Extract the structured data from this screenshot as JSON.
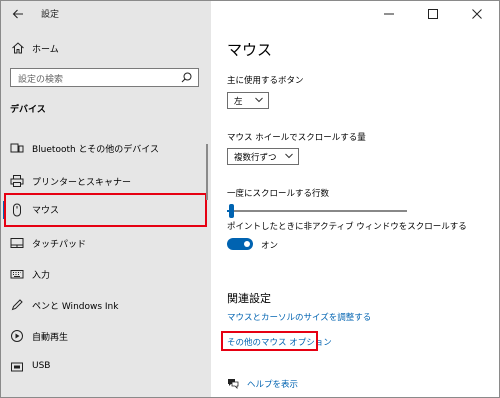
{
  "window": {
    "title": "設定",
    "controls": [
      "minimize-icon",
      "maximize-icon",
      "close-icon"
    ]
  },
  "sidebar": {
    "home_label": "ホーム",
    "search_placeholder": "設定の検索",
    "section_title": "デバイス",
    "items": [
      {
        "label": "Bluetooth とその他のデバイス",
        "icon": "bluetooth-devices-icon"
      },
      {
        "label": "プリンターとスキャナー",
        "icon": "printer-icon"
      },
      {
        "label": "マウス",
        "icon": "mouse-icon",
        "active": true
      },
      {
        "label": "タッチパッド",
        "icon": "touchpad-icon"
      },
      {
        "label": "入力",
        "icon": "keyboard-icon"
      },
      {
        "label": "ペンと Windows Ink",
        "icon": "pen-icon"
      },
      {
        "label": "自動再生",
        "icon": "autoplay-icon"
      },
      {
        "label": "USB",
        "icon": "usb-icon"
      }
    ]
  },
  "main": {
    "title": "マウス",
    "primary_button": {
      "label": "主に使用するボタン",
      "value": "左"
    },
    "wheel_scroll": {
      "label": "マウス ホイールでスクロールする量",
      "value": "複数行ずつ"
    },
    "lines_to_scroll": {
      "label": "一度にスクロールする行数",
      "level": 0.02
    },
    "inactive_scroll": {
      "label": "ポイントしたときに非アクティブ ウィンドウをスクロールする",
      "state": "オン",
      "on": true
    },
    "related": {
      "title": "関連設定",
      "links": [
        "マウスとカーソルのサイズを調整する",
        "その他のマウス オプション"
      ]
    },
    "help_link": "ヘルプを表示"
  },
  "colors": {
    "accent": "#0063b1",
    "highlight": "#e60012",
    "sidebar_bg": "#e6e6e6"
  }
}
